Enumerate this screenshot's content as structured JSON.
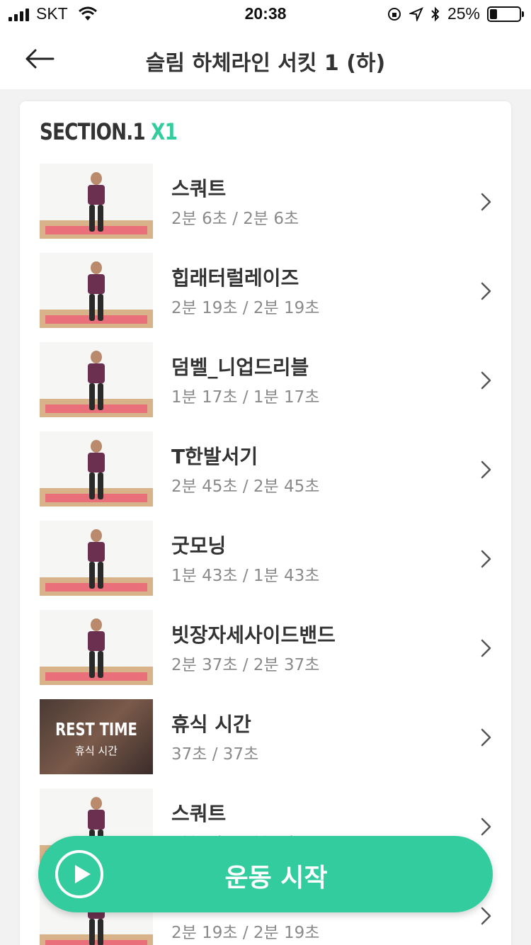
{
  "status_bar": {
    "carrier": "SKT",
    "time": "20:38",
    "battery": "25%",
    "battery_level": 0.25
  },
  "nav": {
    "title": "슬림 하체라인 서킷 1 (하)"
  },
  "section": {
    "label": "SECTION.1",
    "repeat": "X1"
  },
  "exercises": [
    {
      "name": "스쿼트",
      "time": "2분 6초 / 2분 6초",
      "thumb": "squat"
    },
    {
      "name": "힙래터럴레이즈",
      "time": "2분 19초 / 2분 19초",
      "thumb": "hip-lateral-raise"
    },
    {
      "name": "덤벨_니업드리블",
      "time": "1분 17초 / 1분 17초",
      "thumb": "dumbbell-knee-up"
    },
    {
      "name": "T한발서기",
      "time": "2분 45초 / 2분 45초",
      "thumb": "t-balance"
    },
    {
      "name": "굿모닝",
      "time": "1분 43초 / 1분 43초",
      "thumb": "good-morning"
    },
    {
      "name": "빗장자세사이드밴드",
      "time": "2분 37초 / 2분 37초",
      "thumb": "side-bend"
    },
    {
      "name": "휴식 시간",
      "time": "37초 / 37초",
      "thumb": "rest",
      "thumb_title": "REST TIME",
      "thumb_sub": "휴식 시간"
    },
    {
      "name": "스쿼트",
      "time": "2분 6초 / 2분 6초",
      "thumb": "squat"
    },
    {
      "name": "",
      "time": "2분 19초 / 2분 19초",
      "thumb": "hip-lateral-raise"
    }
  ],
  "start_button": {
    "label": "운동 시작"
  },
  "colors": {
    "accent": "#33cc9e",
    "text": "#333333",
    "subtext": "#8a8a8a"
  }
}
